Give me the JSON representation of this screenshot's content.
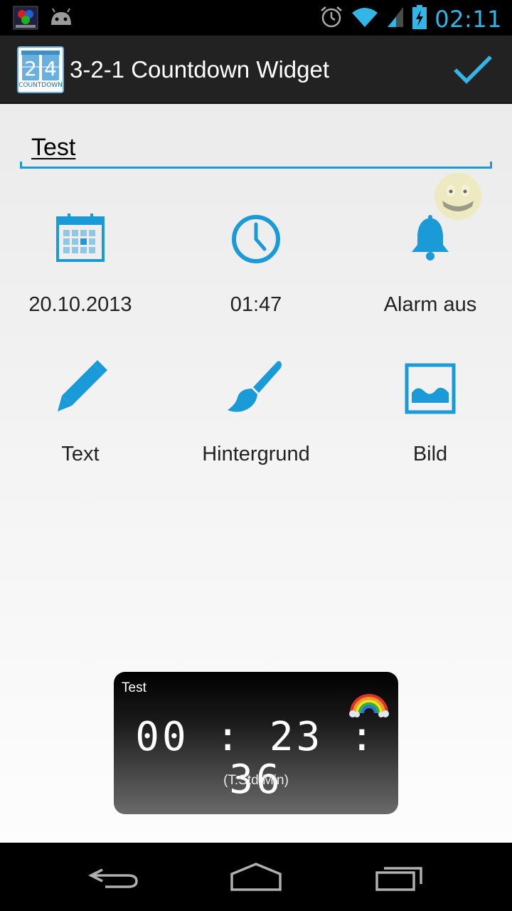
{
  "status_bar": {
    "time": "02:11",
    "icons": [
      "led-blinker-icon",
      "android-icon",
      "alarm-icon",
      "wifi-icon",
      "signal-icon",
      "battery-charging-icon"
    ]
  },
  "action_bar": {
    "title": "3-2-1 Countdown Widget",
    "app_icon_text": "COUNTDOWN",
    "app_icon_digits": "24"
  },
  "name_field": {
    "value": "Test"
  },
  "options": [
    {
      "label": "20.10.2013",
      "icon": "calendar-icon"
    },
    {
      "label": "01:47",
      "icon": "clock-icon"
    },
    {
      "label": "Alarm aus",
      "icon": "bell-icon"
    },
    {
      "label": "Text",
      "icon": "pencil-icon"
    },
    {
      "label": "Hintergrund",
      "icon": "paintbrush-icon"
    },
    {
      "label": "Bild",
      "icon": "image-icon"
    }
  ],
  "widget_preview": {
    "title": "Test",
    "time": "00 : 23 : 36",
    "unit_label": "(T:Std:Min)"
  },
  "colors": {
    "accent": "#33b5e5",
    "icon_blue": "#1a9ad6"
  }
}
